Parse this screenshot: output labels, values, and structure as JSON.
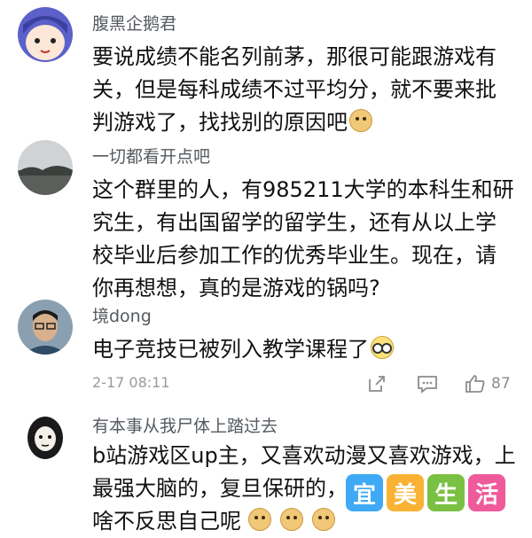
{
  "comments": [
    {
      "username": "腹黑企鹅君",
      "lines": [
        "要说成绩不能名列前茅，那很可能跟游戏有",
        "关，但是每科成绩不过平均分，就不要来批",
        "判游戏了，找找别的原因吧"
      ],
      "emoji": "doge-emoji"
    },
    {
      "username": "一切都看开点吧",
      "lines": [
        "这个群里的人，有985211大学的本科生和研",
        "究生，有出国留学的留学生，还有从以上学",
        "校毕业后参加工作的优秀毕业生。现在，请",
        "你再想想，真的是游戏的锅吗?"
      ]
    },
    {
      "username": "境dong",
      "lines": [
        "电子竞技已被列入教学课程了"
      ],
      "emoji": "glasses-emoji",
      "timestamp": "2-17 08:11",
      "like_count": "87"
    },
    {
      "username": "有本事从我尸体上踏过去",
      "lines": [
        "b站游戏区up主，又喜欢动漫又喜欢游戏，上",
        "最强大脑的，复旦保研的，",
        "啥不反思自己呢"
      ],
      "emojis": [
        "doge-emoji",
        "doge-emoji",
        "doge-emoji"
      ]
    }
  ],
  "watermark": {
    "chars": [
      "宜",
      "美",
      "生",
      "活"
    ],
    "colors": [
      "#3fa9f5",
      "#f9b233",
      "#7ac143",
      "#ef5a9b"
    ]
  },
  "colors": {
    "name": "#555a60",
    "text": "#111111",
    "meta": "#9a9a9a"
  }
}
